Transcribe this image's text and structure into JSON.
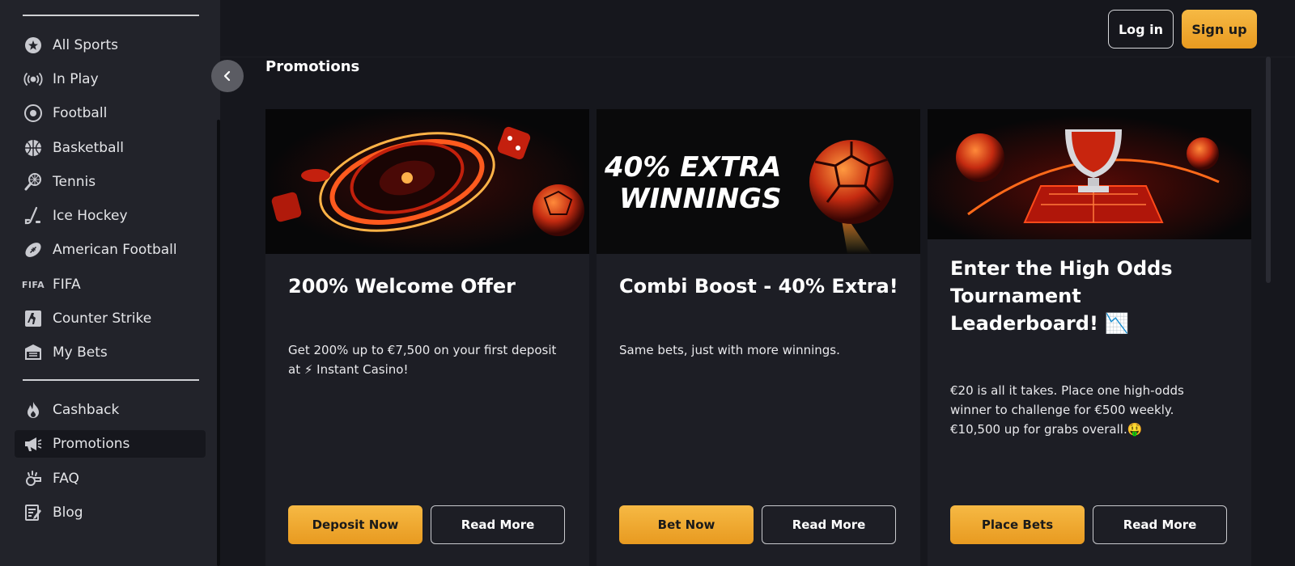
{
  "sidebar": {
    "items": [
      {
        "label": "All Sports",
        "icon": "all-sports-icon"
      },
      {
        "label": "In Play",
        "icon": "live-broadcast-icon"
      },
      {
        "label": "Football",
        "icon": "football-icon"
      },
      {
        "label": "Basketball",
        "icon": "basketball-icon"
      },
      {
        "label": "Tennis",
        "icon": "tennis-icon"
      },
      {
        "label": "Ice Hockey",
        "icon": "hockey-stick-icon"
      },
      {
        "label": "American Football",
        "icon": "american-football-icon"
      },
      {
        "label": "FIFA",
        "icon": "fifa-icon",
        "icon_text": "FIFA"
      },
      {
        "label": "Counter Strike",
        "icon": "counter-strike-icon"
      },
      {
        "label": "My Bets",
        "icon": "my-bets-icon"
      }
    ],
    "secondary": [
      {
        "label": "Cashback",
        "icon": "flame-icon"
      },
      {
        "label": "Promotions",
        "icon": "megaphone-icon",
        "active": true
      },
      {
        "label": "FAQ",
        "icon": "whistle-icon"
      },
      {
        "label": "Blog",
        "icon": "blog-icon"
      }
    ]
  },
  "header": {
    "login_label": "Log in",
    "signup_label": "Sign up"
  },
  "page": {
    "title": "Promotions"
  },
  "promotions": [
    {
      "title": "200% Welcome Offer",
      "description": "Get 200% up to €7,500 on your first deposit at ⚡ Instant Casino!",
      "primary_label": "Deposit Now",
      "secondary_label": "Read More",
      "banner": "roulette-banner"
    },
    {
      "title": "Combi Boost - 40% Extra!",
      "description": "Same bets, just with more winnings.",
      "primary_label": "Bet Now",
      "secondary_label": "Read More",
      "banner": "extra-winnings-banner",
      "banner_text_line1": "40% EXTRA",
      "banner_text_line2": "WINNINGS"
    },
    {
      "title": "Enter the High Odds Tournament Leaderboard! 📉",
      "description": "€20 is all it takes. Place one high-odds winner to challenge for €500 weekly. €10,500 up for grabs overall.🤑",
      "primary_label": "Place Bets",
      "secondary_label": "Read More",
      "banner": "trophy-banner"
    }
  ],
  "colors": {
    "background": "#16171d",
    "sidebar": "#22232a",
    "card": "#1d1e25",
    "accent": "#f0a92e"
  }
}
